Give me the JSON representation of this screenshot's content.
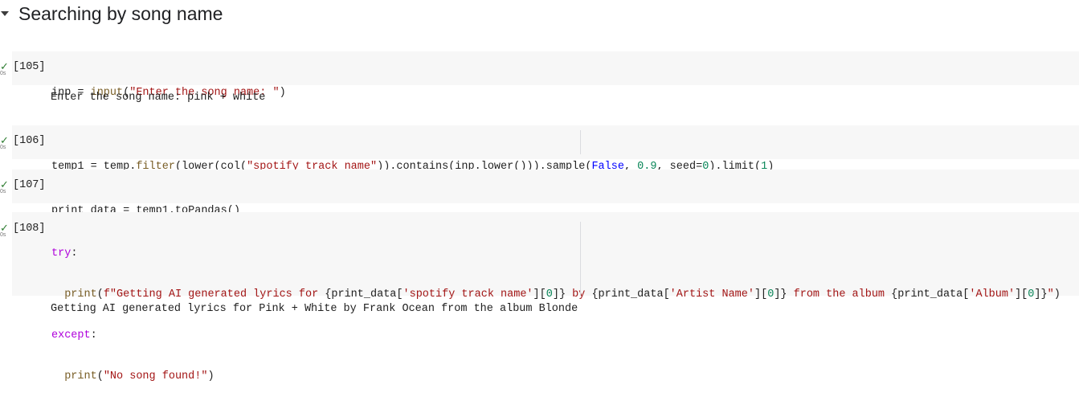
{
  "section": {
    "title": "Searching by song name"
  },
  "cells": [
    {
      "exec": "[105]",
      "duration": "0s",
      "code": {
        "var": "inp = ",
        "fn": "input",
        "open": "(",
        "str": "\"Enter the song name: \"",
        "close": ")"
      },
      "output": "Enter the song name: pink + white"
    },
    {
      "exec": "[106]",
      "duration": "0s",
      "code": {
        "p1": "temp1 = temp.",
        "filter": "filter",
        "p2": "(lower(col(",
        "str": "\"spotify track name\"",
        "p3": ")).contains(inp.lower())).sample(",
        "false": "False",
        "p4": ", ",
        "frac": "0.9",
        "p5": ", seed=",
        "seed": "0",
        "p6": ").limit(",
        "limit": "1",
        "p7": ")"
      }
    },
    {
      "exec": "[107]",
      "duration": "0s",
      "code": {
        "text": "print_data = temp1.toPandas()"
      }
    },
    {
      "exec": "[108]",
      "duration": "0s",
      "code": {
        "try": "try",
        "colon1": ":",
        "print1": "print",
        "open1": "(",
        "f1": "f\"Getting AI generated lyrics for ",
        "e1": "{print_data[",
        "k1": "'spotify track name'",
        "i1": "][",
        "z1": "0",
        "c1": "]}",
        "f2": " by ",
        "e2": "{print_data[",
        "k2": "'Artist Name'",
        "i2": "][",
        "z2": "0",
        "c2": "]}",
        "f3": " from the album ",
        "e3": "{print_data[",
        "k3": "'Album'",
        "i3": "][",
        "z3": "0",
        "c3": "]}",
        "q": "\"",
        "close1": ")",
        "except": "except",
        "colon2": ":",
        "print2": "print",
        "open2": "(",
        "s2": "\"No song found!\"",
        "close2": ")"
      },
      "output": "Getting AI generated lyrics for Pink + White by Frank Ocean from the album Blonde"
    }
  ]
}
